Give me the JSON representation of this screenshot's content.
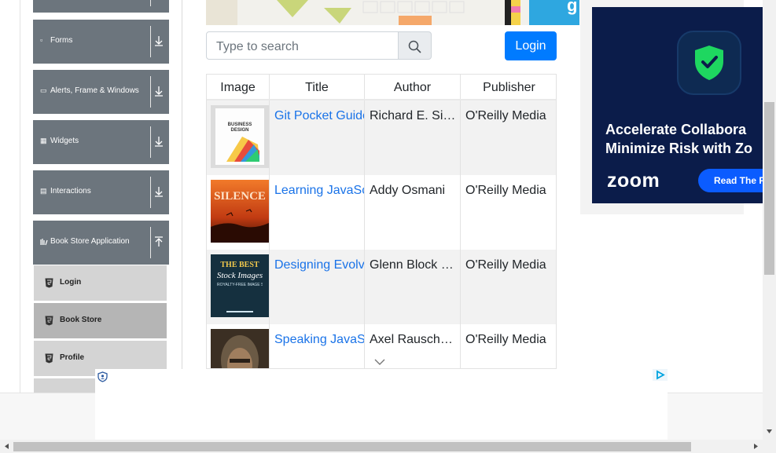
{
  "sidebar": {
    "groups": [
      {
        "label": "",
        "icon": "collapse-icon"
      },
      {
        "label": "Forms",
        "icon": "form-icon"
      },
      {
        "label": "Alerts, Frame & Windows",
        "icon": "window-icon"
      },
      {
        "label": "Widgets",
        "icon": "grid-icon"
      },
      {
        "label": "Interactions",
        "icon": "list-icon"
      },
      {
        "label": "Book Store Application",
        "icon": "book-icon"
      }
    ],
    "items": [
      {
        "label": "Login"
      },
      {
        "label": "Book Store"
      },
      {
        "label": "Profile"
      }
    ]
  },
  "search": {
    "placeholder": "Type to search"
  },
  "login_label": "Login",
  "table": {
    "headers": [
      "Image",
      "Title",
      "Author",
      "Publisher"
    ],
    "rows": [
      {
        "title": "Git Pocket Guide",
        "author": "Richard E. Silverman",
        "publisher": "O'Reilly Media"
      },
      {
        "title": "Learning JavaScript Design Patterns",
        "author": "Addy Osmani",
        "publisher": "O'Reilly Media"
      },
      {
        "title": "Designing Evolvable Web APIs with ASP.NET",
        "author": "Glenn Block et al.",
        "publisher": "O'Reilly Media"
      },
      {
        "title": "Speaking JavaScript",
        "author": "Axel Rauschmayer",
        "publisher": "O'Reilly Media"
      }
    ]
  },
  "covers": [
    {
      "line1": "BUSINESS",
      "line2": "DESIGN"
    },
    {
      "line1": "SILENCE"
    },
    {
      "line1": "THE BEST",
      "line2": "Stock Images",
      "line3": "ROYALTY-FREE IMAGE SITES FOR BOOK COVERS"
    },
    {}
  ],
  "ad": {
    "line1": "Accelerate Collabora",
    "line2": "Minimize Risk with Zo",
    "brand": "zoom",
    "cta": "Read The R",
    "top_fragment": "g"
  },
  "colors": {
    "primary": "#007bff",
    "sidebar": "#6c757d",
    "link": "#1a73e8"
  }
}
